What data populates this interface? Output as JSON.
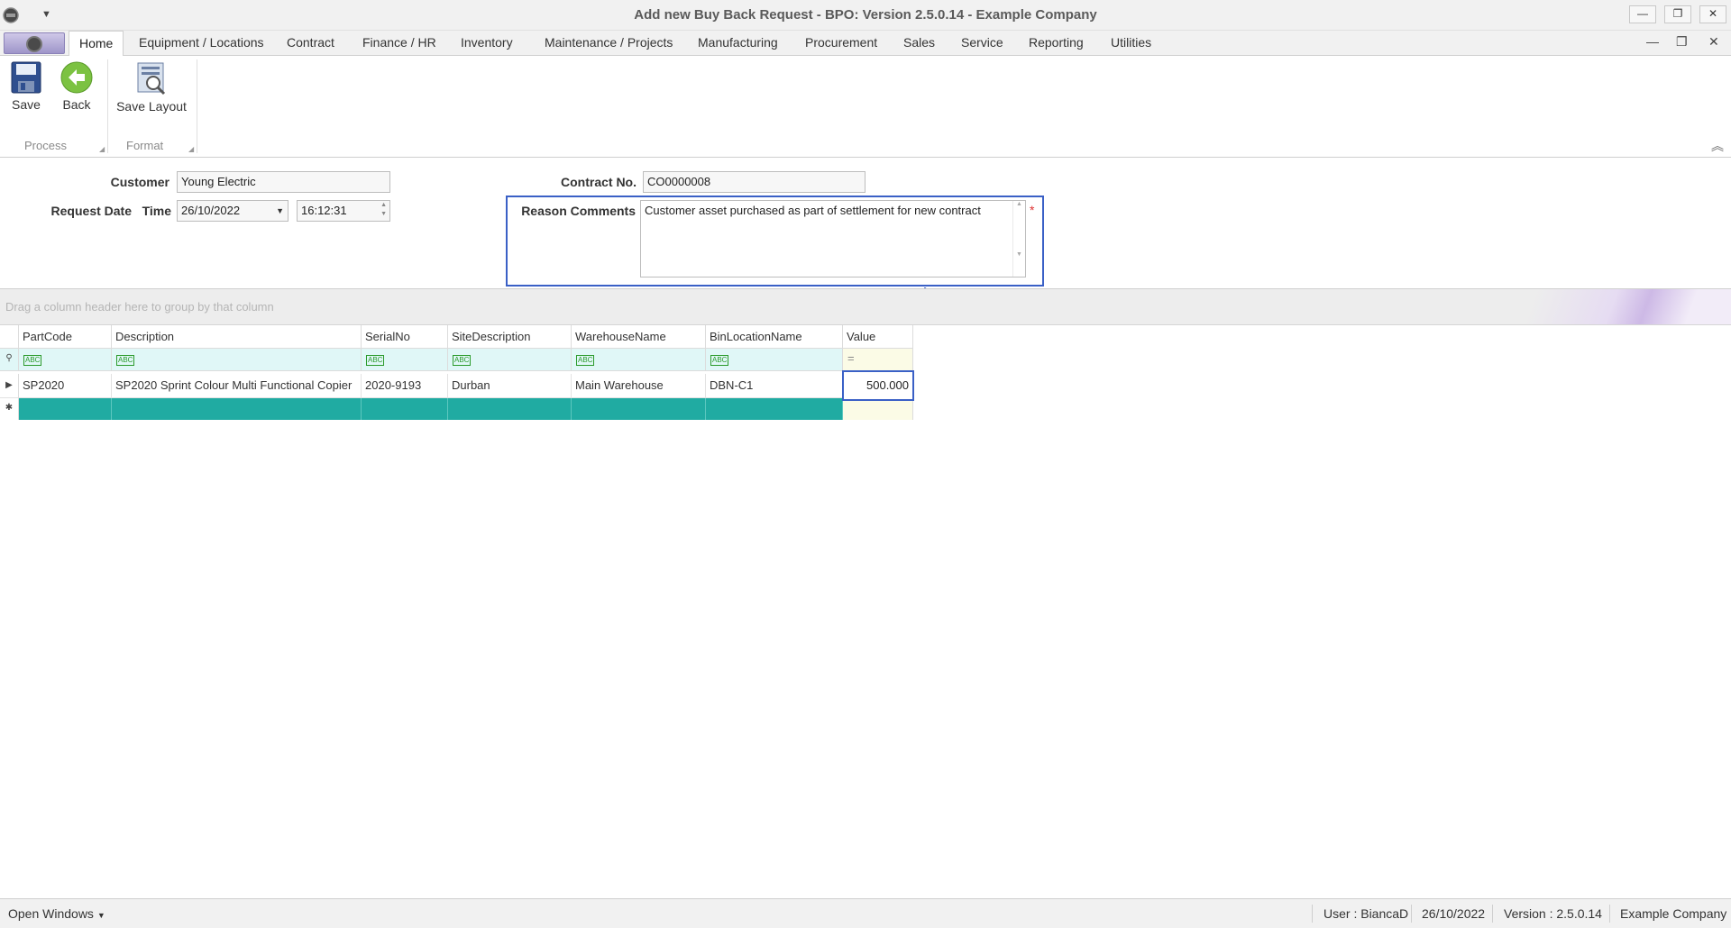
{
  "window": {
    "title": "Add new Buy Back Request - BPO: Version 2.5.0.14 - Example Company",
    "minimize_icon": "minimize-icon",
    "restore_icon": "restore-icon",
    "close_icon": "close-icon"
  },
  "ribbon_tabs": [
    "Home",
    "Equipment / Locations",
    "Contract",
    "Finance / HR",
    "Inventory",
    "Maintenance / Projects",
    "Manufacturing",
    "Procurement",
    "Sales",
    "Service",
    "Reporting",
    "Utilities"
  ],
  "ribbon": {
    "save": "Save",
    "back": "Back",
    "save_layout": "Save Layout",
    "group_process": "Process",
    "group_format": "Format"
  },
  "form": {
    "customer_label": "Customer",
    "customer_value": "Young Electric",
    "request_date_label": "Request Date",
    "time_label": "Time",
    "request_date_value": "26/10/2022",
    "time_value": "16:12:31",
    "contract_label": "Contract No.",
    "contract_value": "CO0000008",
    "reason_label": "Reason Comments",
    "reason_value": "Customer asset purchased as part of settlement for new contract",
    "required_mark": "*"
  },
  "grid": {
    "group_hint": "Drag a column header here to group by that column",
    "columns": [
      "PartCode",
      "Description",
      "SerialNo",
      "SiteDescription",
      "WarehouseName",
      "BinLocationName",
      "Value"
    ],
    "filter_text_icon": "ABC",
    "filter_value_icon": "=",
    "rows": [
      {
        "PartCode": "SP2020",
        "Description": "SP2020 Sprint Colour Multi Functional Copier",
        "SerialNo": "2020-9193",
        "SiteDescription": "Durban",
        "WarehouseName": "Main Warehouse",
        "BinLocationName": "DBN-C1",
        "Value": "500.000"
      }
    ]
  },
  "status": {
    "open_windows": "Open Windows",
    "user": "User : BiancaD",
    "date": "26/10/2022",
    "version": "Version : 2.5.0.14",
    "company": "Example Company"
  },
  "colors": {
    "accent_highlight": "#3a60c6",
    "new_row": "#20aba2",
    "filter_row": "#e0f7f7",
    "required": "#dd3333"
  }
}
